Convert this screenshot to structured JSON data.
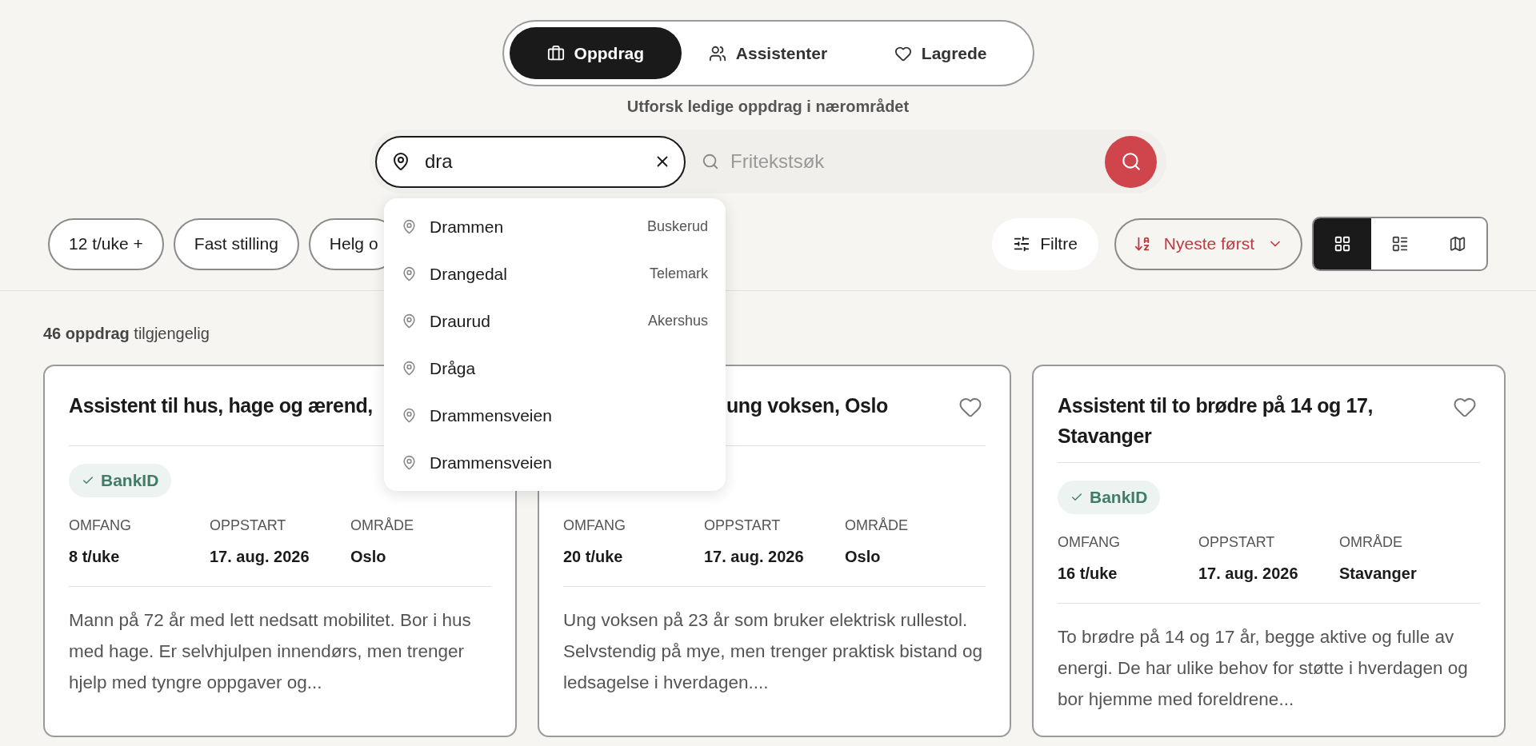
{
  "tabs": [
    {
      "label": "Oppdrag",
      "selected": true
    },
    {
      "label": "Assistenter",
      "selected": false
    },
    {
      "label": "Lagrede",
      "selected": false
    }
  ],
  "subtitle": "Utforsk ledige oppdrag i nærområdet",
  "search": {
    "location_value": "dra",
    "text_placeholder": "Fritekstsøk"
  },
  "suggestions": [
    {
      "place": "Drammen",
      "region": "Buskerud"
    },
    {
      "place": "Drangedal",
      "region": "Telemark"
    },
    {
      "place": "Draurud",
      "region": "Akershus"
    },
    {
      "place": "Dråga"
    },
    {
      "place": "Drammensveien"
    },
    {
      "place": "Drammensveien"
    }
  ],
  "filter_chips": [
    "12 t/uke +",
    "Fast stilling",
    "Helg o"
  ],
  "filters_button": "Filtre",
  "sort": {
    "label": "Nyeste først"
  },
  "views": [
    {
      "selected": true
    },
    {
      "selected": false
    },
    {
      "selected": false
    }
  ],
  "result_count": "**46 oppdrag** tilgjengelig",
  "cards": [
    {
      "title": "Assistent til hus, hage og ærend,",
      "title_partly_hidden": false,
      "badge": "BankID",
      "fields": [
        {
          "label": "OMFANG",
          "value": "8 t/uke"
        },
        {
          "label": "OPPSTART",
          "value": "17. aug. 2026"
        },
        {
          "label": "OMRÅDE",
          "value": "Oslo"
        }
      ],
      "description": "Mann på 72 år med lett nedsatt mobilitet. Bor i hus med hage. Er selvhjulpen innendørs, men trenger hjelp med tyngre oppgaver og..."
    },
    {
      "title": "ung voksen, Oslo",
      "title_partly_hidden": true,
      "favorite_button": true,
      "fields": [
        {
          "label": "OMFANG",
          "value": "20 t/uke"
        },
        {
          "label": "OPPSTART",
          "value": "17. aug. 2026"
        },
        {
          "label": "OMRÅDE",
          "value": "Oslo"
        }
      ],
      "description": "Ung voksen på 23 år som bruker elektrisk rullestol. Selvstendig på mye, men trenger praktisk bistand og ledsagelse i hverdagen...."
    },
    {
      "title": "Assistent til to brødre på 14 og 17, Stavanger",
      "title_partly_hidden": false,
      "favorite_button": true,
      "badge": "BankID",
      "fields": [
        {
          "label": "OMFANG",
          "value": "16 t/uke"
        },
        {
          "label": "OPPSTART",
          "value": "17. aug. 2026"
        },
        {
          "label": "OMRÅDE",
          "value": "Stavanger"
        }
      ],
      "description": "To brødre på 14 og 17 år, begge aktive og fulle av energi. De har ulike behov for støtte i hverdagen og bor hjemme med foreldrene..."
    }
  ]
}
